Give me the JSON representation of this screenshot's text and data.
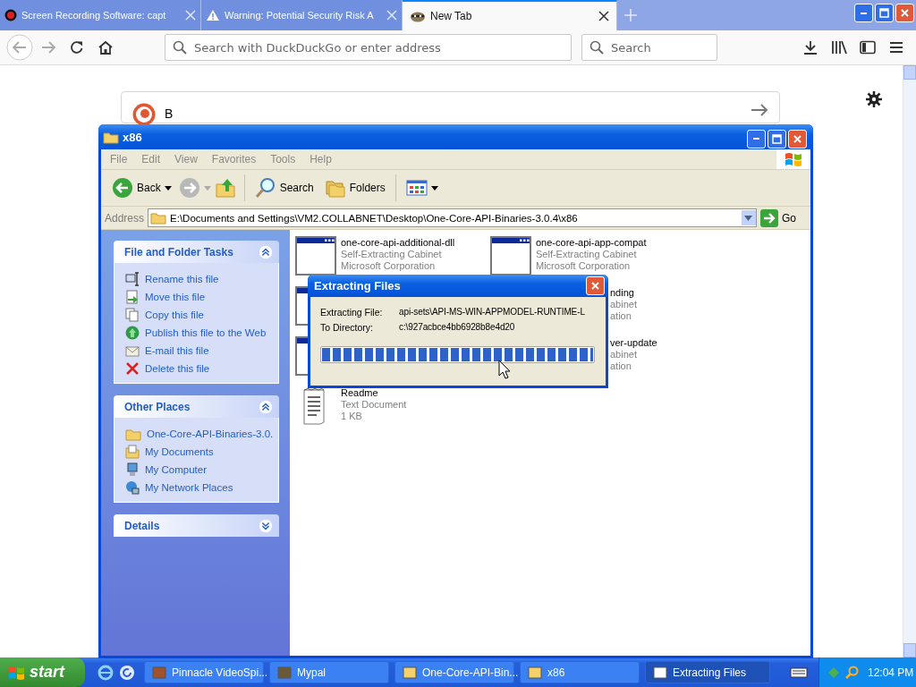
{
  "browser": {
    "tabs": [
      {
        "title": "Screen Recording Software: capt",
        "selected": false
      },
      {
        "title": "Warning: Potential Security Risk A",
        "selected": false
      },
      {
        "title": "New Tab",
        "selected": true
      }
    ],
    "address": {
      "placeholder": "Search with DuckDuckGo or enter address"
    },
    "search": {
      "placeholder": "Search"
    },
    "page": {
      "query": "B"
    }
  },
  "explorer": {
    "title": "x86",
    "menu": [
      "File",
      "Edit",
      "View",
      "Favorites",
      "Tools",
      "Help"
    ],
    "toolbar": {
      "back": "Back",
      "search": "Search",
      "folders": "Folders"
    },
    "address": {
      "label": "Address",
      "path": "E:\\Documents and Settings\\VM2.COLLABNET\\Desktop\\One-Core-API-Binaries-3.0.4\\x86",
      "go": "Go"
    },
    "panels": [
      {
        "title": "File and Folder Tasks",
        "expanded": true,
        "items": [
          "Rename this file",
          "Move this file",
          "Copy this file",
          "Publish this file to the Web",
          "E-mail this file",
          "Delete this file"
        ]
      },
      {
        "title": "Other Places",
        "expanded": true,
        "items": [
          "One-Core-API-Binaries-3.0.",
          "My Documents",
          "My Computer",
          "My Network Places"
        ]
      },
      {
        "title": "Details",
        "expanded": false
      }
    ],
    "files": [
      {
        "kind": "installer",
        "name": "one-core-api-additional-dll",
        "type": "Self-Extracting Cabinet",
        "company": "Microsoft Corporation"
      },
      {
        "kind": "installer",
        "name": "one-core-api-app-compat",
        "type": "Self-Extracting Cabinet",
        "company": "Microsoft Corporation"
      },
      {
        "kind": "icon-edge"
      },
      {
        "kind": "text-edge",
        "name": "nding",
        "type": "abinet",
        "company": "ation"
      },
      {
        "kind": "icon-edge"
      },
      {
        "kind": "text-edge",
        "name": "ver-update",
        "type": "abinet",
        "company": "ation"
      },
      {
        "kind": "document",
        "name": "Readme",
        "type": "Text Document",
        "company": "1 KB"
      }
    ]
  },
  "dialog": {
    "title": "Extracting Files",
    "rows": [
      {
        "label": "Extracting File:",
        "value": "api-sets\\API-MS-WIN-APPMODEL-RUNTIME-L"
      },
      {
        "label": "To Directory:",
        "value": "c:\\927acbce4bb6928b8e4d20"
      }
    ],
    "progress": {
      "level": 1
    }
  },
  "taskbar": {
    "start": "start",
    "tasks": [
      {
        "label": "Pinnacle VideoSpi...",
        "selected": false
      },
      {
        "label": "Mypal",
        "selected": false
      },
      {
        "label": "One-Core-API-Bin...",
        "selected": false
      },
      {
        "label": "x86",
        "selected": false
      },
      {
        "label": "Extracting Files",
        "selected": true
      }
    ],
    "clock": "12:04 PM"
  }
}
